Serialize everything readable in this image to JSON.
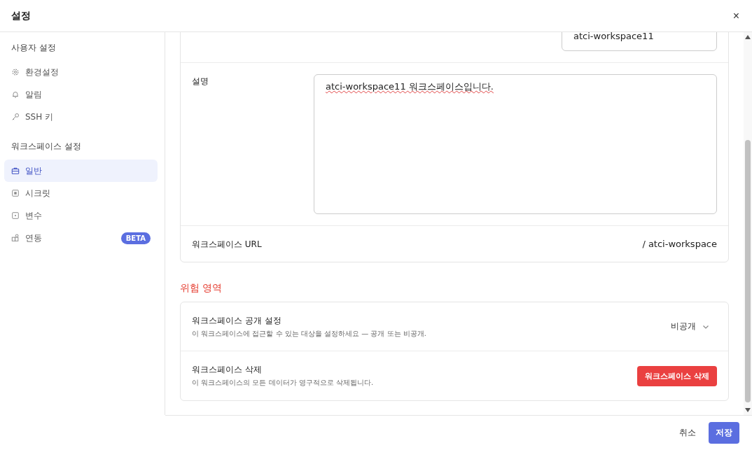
{
  "window": {
    "title": "설정",
    "close": "×"
  },
  "sidebar": {
    "sections": [
      {
        "title": "사용자 설정",
        "items": [
          {
            "label": "환경설정",
            "selected": false
          },
          {
            "label": "알림",
            "selected": false
          },
          {
            "label": "SSH 키",
            "selected": false
          }
        ]
      },
      {
        "title": "워크스페이스 설정",
        "items": [
          {
            "label": "일반",
            "selected": true
          },
          {
            "label": "시크릿",
            "selected": false
          },
          {
            "label": "변수",
            "selected": false
          },
          {
            "label": "연동",
            "selected": false,
            "badge": "BETA"
          }
        ]
      }
    ]
  },
  "general": {
    "name_value": "atci-workspace11",
    "description_label": "설명",
    "description_value": "atci-workspace11 워크스페이스입니다.",
    "url_label": "워크스페이스 URL",
    "url_value": "/ atci-workspace"
  },
  "danger_zone": {
    "title": "위험 영역",
    "rows": [
      {
        "kind": "select",
        "title": "워크스페이스 공개 설정",
        "description": "이 워크스페이스에 접근할 수 있는 대상을 설정하세요 — 공개 또는 비공개.",
        "value": "비공개"
      },
      {
        "kind": "button",
        "title": "워크스페이스 삭제",
        "description": "이 워크스페이스의 모든 데이터가 영구적으로 삭제됩니다.",
        "action": "워크스페이스 삭제"
      }
    ]
  },
  "footer": {
    "cancel": "취소",
    "save": "저장"
  }
}
